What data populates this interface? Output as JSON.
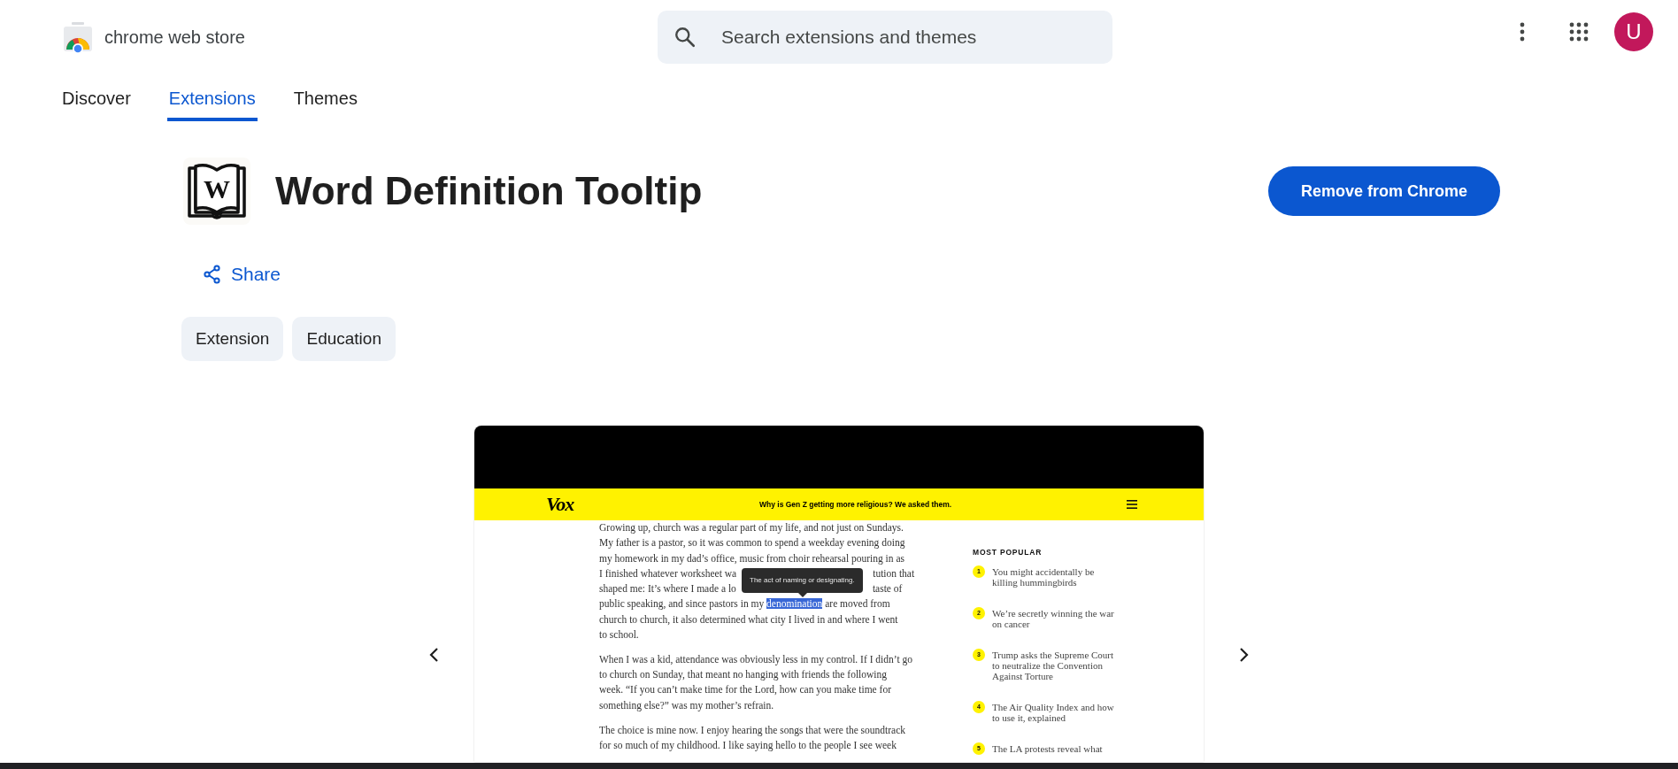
{
  "header": {
    "store_name": "chrome web store",
    "search": {
      "placeholder": "Search extensions and themes"
    },
    "avatar": "U"
  },
  "tabs": [
    {
      "label": "Discover",
      "selected": false
    },
    {
      "label": "Extensions",
      "selected": true
    },
    {
      "label": "Themes",
      "selected": false
    }
  ],
  "extension": {
    "icon_letter": "W",
    "title": "Word Definition Tooltip",
    "action": "Remove from Chrome",
    "share": "Share",
    "chips": [
      "Extension",
      "Education"
    ]
  },
  "screenshot": {
    "site_logo": "Vox",
    "headline": "Why is Gen Z getting more religious? We asked them.",
    "tooltip": "The act of naming or designating.",
    "article": [
      {
        "lines": [
          {
            "kind": "plain",
            "text": "Growing up, church was a regular part of my life, and not just on Sundays."
          },
          {
            "kind": "plain",
            "text": "My father is a pastor, so it was common to spend a weekday evening doing"
          },
          {
            "kind": "plain",
            "text": "my homework in my dad’s office, music from choir rehearsal pouring in as"
          },
          {
            "kind": "covered",
            "fragments": [
              "I finished whatever worksheet wa",
              "tution that"
            ]
          },
          {
            "kind": "covered",
            "fragments": [
              "shaped me: It’s where I made a lo",
              "taste of"
            ]
          },
          {
            "kind": "marked",
            "before": "public speaking, and since pastors in my ",
            "selected_word": "denomination",
            "after": " are moved from"
          },
          {
            "kind": "plain",
            "text": "church to church, it also determined what city I lived in and where I went"
          },
          {
            "kind": "plain",
            "text": "to school."
          }
        ]
      },
      {
        "lines": [
          {
            "kind": "plain",
            "text": "When I was a kid, attendance was obviously less in my control. If I didn’t go"
          },
          {
            "kind": "plain",
            "text": "to church on Sunday, that meant no hanging with friends the following"
          },
          {
            "kind": "plain",
            "text": "week. “If you can’t make time for the Lord, how can you make time for"
          },
          {
            "kind": "plain",
            "text": "something else?” was my mother’s refrain."
          }
        ]
      },
      {
        "lines": [
          {
            "kind": "plain",
            "text": "The choice is mine now. I enjoy hearing the songs that were the soundtrack"
          },
          {
            "kind": "plain",
            "text": "for so much of my childhood. I like saying hello to the people I see week"
          }
        ]
      }
    ],
    "most_popular": {
      "title": "MOST POPULAR",
      "items": [
        {
          "number": "1",
          "title_lines": [
            "You might accidentally be",
            "killing hummingbirds"
          ]
        },
        {
          "number": "2",
          "title_lines": [
            "We’re secretly winning the war",
            "on cancer"
          ]
        },
        {
          "number": "3",
          "title_lines": [
            "Trump asks the Supreme Court",
            "to neutralize the Convention",
            "Against Torture"
          ]
        },
        {
          "number": "4",
          "title_lines": [
            "The Air Quality Index and how",
            "to use it, explained"
          ]
        },
        {
          "number": "5",
          "title_lines": [
            "The LA protests reveal what"
          ]
        }
      ]
    }
  }
}
